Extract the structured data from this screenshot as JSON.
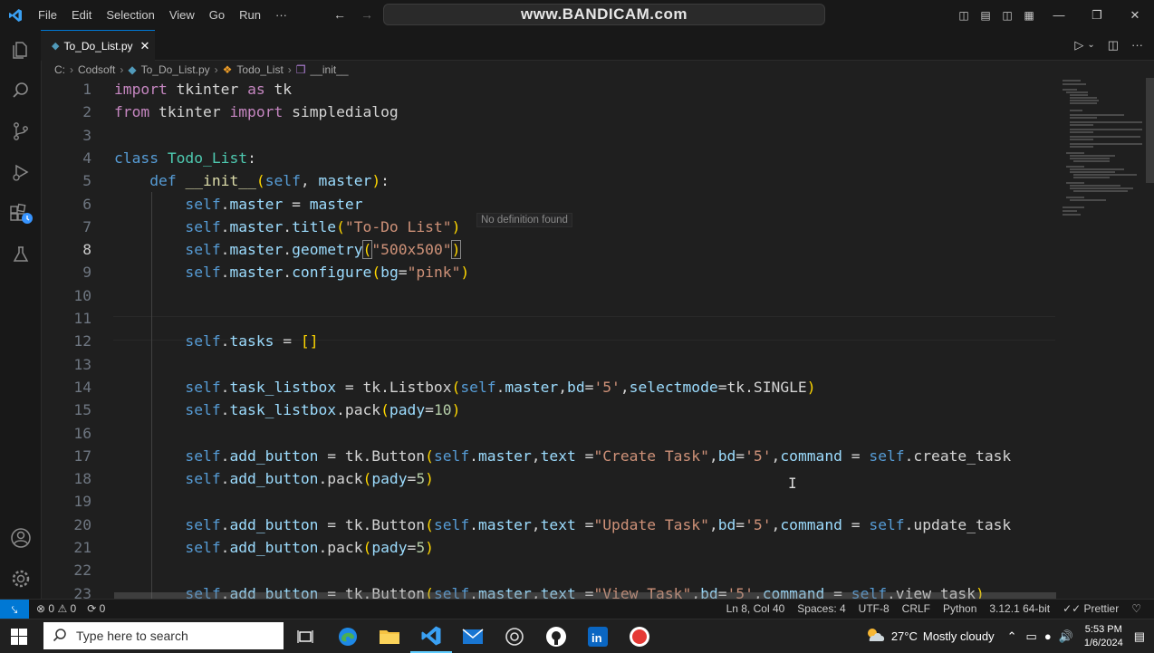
{
  "window": {
    "menu": [
      "File",
      "Edit",
      "Selection",
      "View",
      "Go",
      "Run",
      "···"
    ],
    "search_text": "www.BANDICAM.com"
  },
  "tab": {
    "filename": "To_Do_List.py"
  },
  "breadcrumb": {
    "folder1": "C:",
    "folder2": "Codsoft",
    "file": "To_Do_List.py",
    "class": "Todo_List",
    "method": "__init__"
  },
  "hint": "No definition found",
  "code": {
    "line_numbers": [
      "1",
      "2",
      "3",
      "4",
      "5",
      "6",
      "7",
      "8",
      "9",
      "10",
      "11",
      "12",
      "13",
      "14",
      "15",
      "16",
      "17",
      "18",
      "19",
      "20",
      "21",
      "22",
      "23"
    ],
    "current_line_index": 7
  },
  "status": {
    "problems_errors": "0",
    "problems_warnings": "0",
    "ports": "0",
    "position": "Ln 8, Col 40",
    "spaces": "Spaces: 4",
    "encoding": "UTF-8",
    "eol": "CRLF",
    "language": "Python",
    "interpreter": "3.12.1 64-bit",
    "formatter": "Prettier"
  },
  "taskbar": {
    "search_placeholder": "Type here to search",
    "weather_temp": "27°C",
    "weather_desc": "Mostly cloudy",
    "time": "5:53 PM",
    "date": "1/6/2024"
  },
  "colors": {
    "accent": "#0078d4",
    "editor_bg": "#1f1f1f",
    "keyword": "#c586c0",
    "string": "#ce9178"
  }
}
